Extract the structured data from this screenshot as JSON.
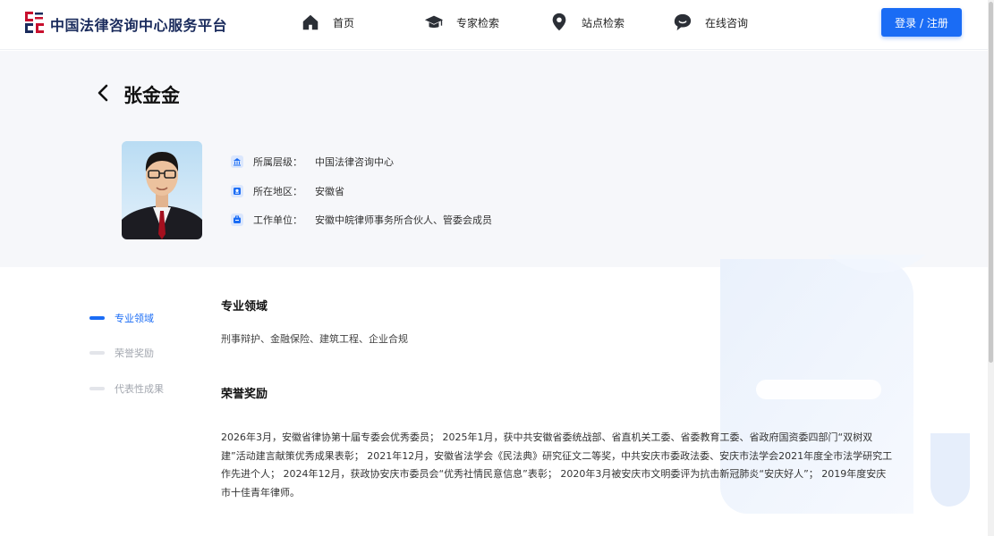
{
  "header": {
    "site_title": "中国法律咨询中心服务平台",
    "logo_icon": "law-center-logo-icon",
    "nav": [
      {
        "label": "首页",
        "icon": "home-icon"
      },
      {
        "label": "专家检索",
        "icon": "graduation-cap-icon"
      },
      {
        "label": "站点检索",
        "icon": "location-pin-icon"
      },
      {
        "label": "在线咨询",
        "icon": "chat-bubble-icon"
      }
    ],
    "login_label": "登录 / 注册"
  },
  "profile": {
    "name": "张金金",
    "fields": [
      {
        "label": "所属层级：",
        "value": "中国法律咨询中心",
        "icon": "institution-icon"
      },
      {
        "label": "所在地区：",
        "value": "安徽省",
        "icon": "location-icon"
      },
      {
        "label": "工作单位：",
        "value": "安徽中皖律师事务所合伙人、管委会成员",
        "icon": "briefcase-icon"
      }
    ]
  },
  "side_nav": [
    {
      "label": "专业领域",
      "active": true
    },
    {
      "label": "荣誉奖励",
      "active": false
    },
    {
      "label": "代表性成果",
      "active": false
    }
  ],
  "sections": {
    "expertise_title": "专业领域",
    "expertise_text": "刑事辩护、金融保险、建筑工程、企业合规",
    "honors_title": "荣誉奖励",
    "honors_text": "2026年3月，安徽省律协第十届专委会优秀委员； 2025年1月，获中共安徽省委统战部、省直机关工委、省委教育工委、省政府国资委四部门“双树双建”活动建言献策优秀成果表彰； 2021年12月，安徽省法学会《民法典》研究征文二等奖，中共安庆市委政法委、安庆市法学会2021年度全市法学研究工作先进个人； 2024年12月，获政协安庆市委员会“优秀社情民意信息”表彰； 2020年3月被安庆市文明委评为抗击新冠肺炎“安庆好人”； 2019年度安庆市十佳青年律师。"
  },
  "colors": {
    "accent": "#1a6cf5",
    "brand_text": "#1a2b5c",
    "band_bg": "#f6f7fa"
  }
}
